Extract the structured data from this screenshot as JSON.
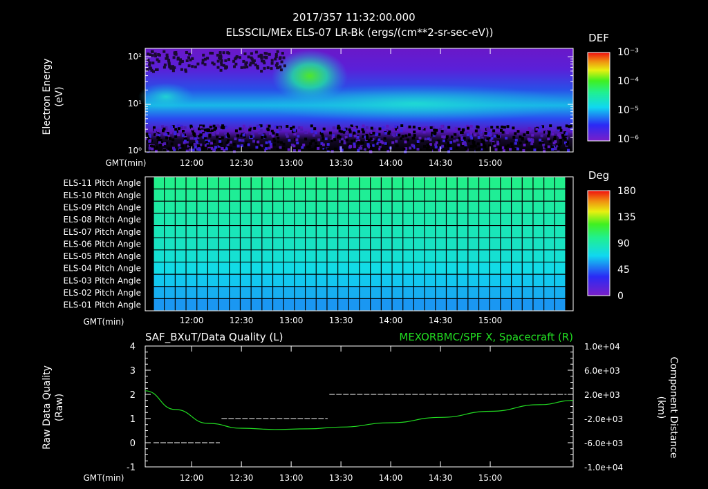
{
  "header": {
    "timestamp": "2017/357 11:32:00.000",
    "subtitle": "ELSSCIL/MEx ELS-07 LR-Bk  (ergs/(cm**2-sr-sec-eV))"
  },
  "panel1": {
    "ylabel_line1": "Electron Energy",
    "ylabel_line2": "(eV)",
    "ytick_labels": [
      "10²",
      "10¹",
      "10⁰"
    ],
    "colorbar_label": "DEF",
    "colorbar_ticks": [
      "10⁻³",
      "10⁻⁴",
      "10⁻⁵",
      "10⁻⁶"
    ],
    "xaxis_title": "GMT(min)",
    "xtick_labels": [
      "12:00",
      "12:30",
      "13:00",
      "13:30",
      "14:00",
      "14:30",
      "15:00"
    ]
  },
  "panel2": {
    "row_labels": [
      "ELS-11 Pitch Angle",
      "ELS-10 Pitch Angle",
      "ELS-09 Pitch Angle",
      "ELS-08 Pitch Angle",
      "ELS-07 Pitch Angle",
      "ELS-06 Pitch Angle",
      "ELS-05 Pitch Angle",
      "ELS-04 Pitch Angle",
      "ELS-03 Pitch Angle",
      "ELS-02 Pitch Angle",
      "ELS-01 Pitch Angle"
    ],
    "colorbar_label": "Deg",
    "colorbar_ticks": [
      "180",
      "135",
      "90",
      "45",
      "0"
    ],
    "xaxis_title": "GMT(min)",
    "xtick_labels": [
      "12:00",
      "12:30",
      "13:00",
      "13:30",
      "14:00",
      "14:30",
      "15:00"
    ]
  },
  "panel3": {
    "title_left": "SAF_BXuT/Data Quality (L)",
    "title_right": "MEXORBMC/SPF X, Spacecraft (R)",
    "ylabel_left_line1": "Raw Data Quality",
    "ylabel_left_line2": "(Raw)",
    "ylabel_right_line1": "Component Distance",
    "ylabel_right_line2": "(km)",
    "left_ticks": [
      "4",
      "3",
      "2",
      "1",
      "0",
      "-1"
    ],
    "right_ticks": [
      "1.0e+04",
      "6.0e+03",
      "2.0e+03",
      "-2.0e+03",
      "-6.0e+03",
      "-1.0e+04"
    ],
    "xaxis_title": "GMT(min)",
    "xtick_labels": [
      "12:00",
      "12:30",
      "13:00",
      "13:30",
      "14:00",
      "14:30",
      "15:00"
    ]
  },
  "colors": {
    "grid_green": "#44ee00",
    "grid_cyan": "#22d8e0",
    "spacecraft_line": "#22dd22"
  },
  "chart_data": [
    {
      "type": "heatmap",
      "title": "ELSSCIL/MEx ELS-07 LR-Bk  (ergs/(cm**2-sr-sec-eV))",
      "xlabel": "GMT(min)",
      "ylabel": "Electron Energy (eV)",
      "y_scale": "log",
      "ylim": [
        1,
        150
      ],
      "x_range": [
        "11:32",
        "15:50"
      ],
      "colorbar": {
        "label": "DEF",
        "scale": "log",
        "range": [
          1e-06,
          0.001
        ]
      },
      "features": [
        {
          "time": "11:32-11:45",
          "energy_eV": [
            10,
            25
          ],
          "level": "1e-5"
        },
        {
          "time": "12:55-13:10",
          "energy_eV": [
            30,
            120
          ],
          "level": "1e-4"
        },
        {
          "time": "13:30-15:50",
          "energy_eV": [
            5,
            40
          ],
          "level": "1e-5"
        }
      ]
    },
    {
      "type": "heatmap",
      "title": "",
      "xlabel": "GMT(min)",
      "categories": [
        "ELS-11",
        "ELS-10",
        "ELS-09",
        "ELS-08",
        "ELS-07",
        "ELS-06",
        "ELS-05",
        "ELS-04",
        "ELS-03",
        "ELS-02",
        "ELS-01"
      ],
      "colorbar": {
        "label": "Deg",
        "range": [
          0,
          180
        ]
      },
      "values_deg": [
        100,
        97,
        93,
        89,
        86,
        83,
        78,
        72,
        65,
        60,
        55
      ],
      "time_columns": 38
    },
    {
      "type": "line",
      "title": "SAF_BXuT/Data Quality (L)",
      "xlabel": "GMT(min)",
      "ylabel": "Raw Data Quality (Raw)",
      "ylim": [
        -1,
        4
      ],
      "y2label": "Component Distance (km)",
      "y2lim": [
        -10000,
        10000
      ],
      "series": [
        {
          "name": "SAF_BXuT/Data Quality",
          "axis": "left",
          "style": "dashed-white",
          "x": [
            "11:37",
            "12:17",
            "12:18",
            "13:22",
            "13:23",
            "15:46"
          ],
          "y": [
            0,
            0,
            1,
            1,
            2,
            2
          ]
        },
        {
          "name": "MEXORBMC/SPF X, Spacecraft",
          "axis": "right",
          "style": "solid-green",
          "x": [
            "11:32",
            "11:50",
            "12:10",
            "12:30",
            "12:50",
            "13:10",
            "13:30",
            "14:00",
            "14:30",
            "15:00",
            "15:30",
            "15:50"
          ],
          "y": [
            2600,
            -500,
            -2800,
            -3600,
            -3800,
            -3700,
            -3400,
            -2700,
            -1800,
            -800,
            300,
            1000
          ]
        }
      ]
    }
  ]
}
